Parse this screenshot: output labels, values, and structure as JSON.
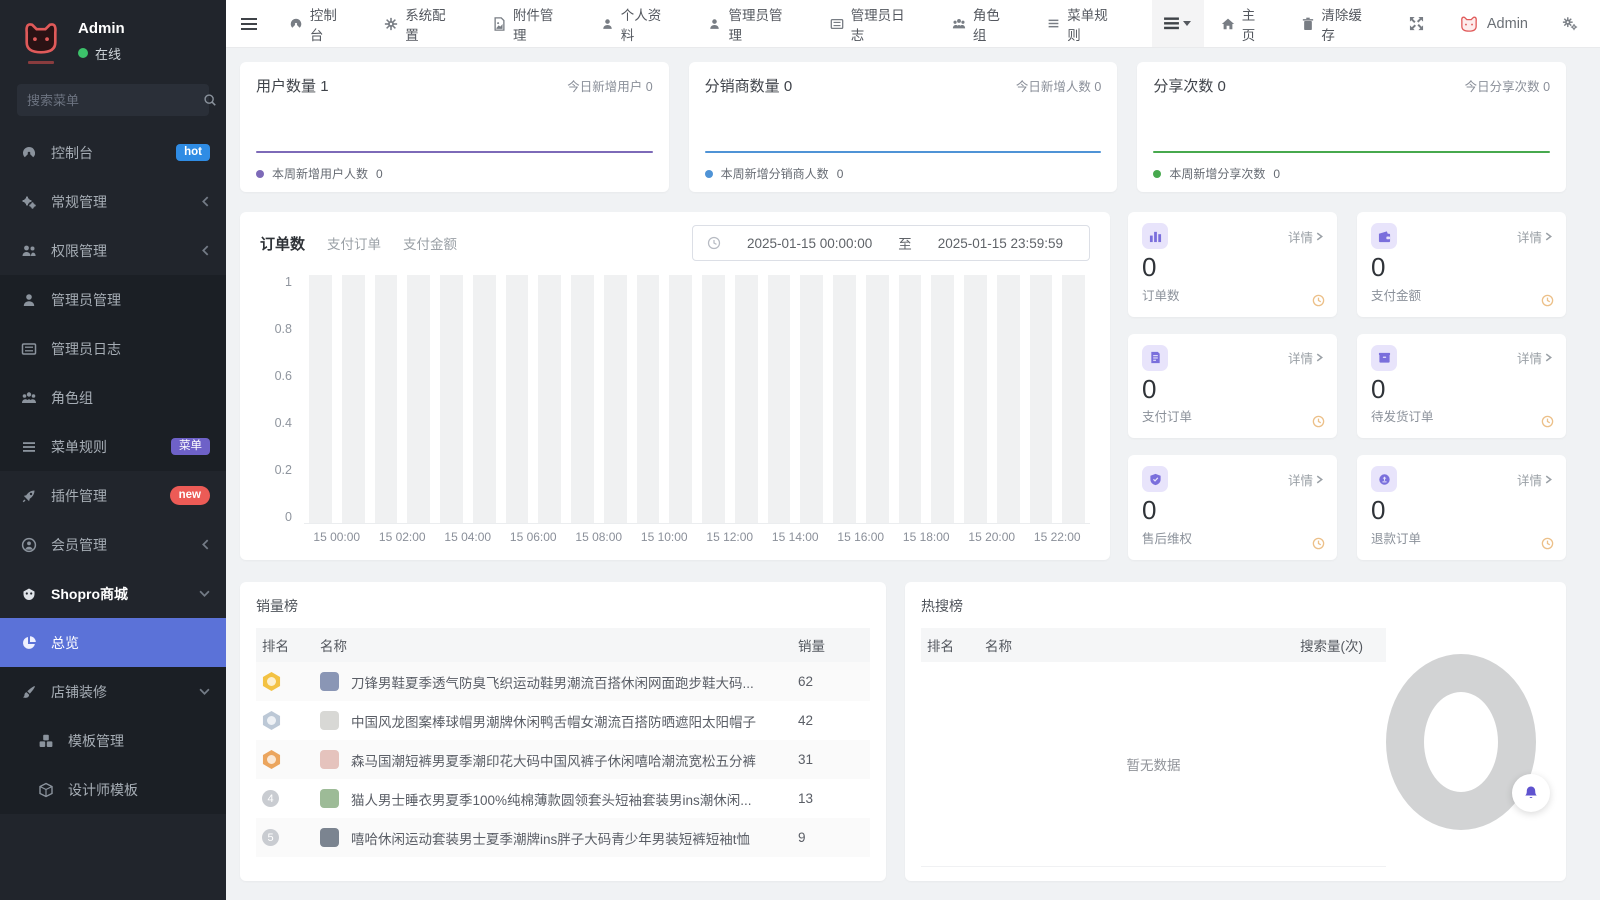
{
  "topbar": {
    "menu": [
      {
        "icon": "dashboard-icon",
        "label": "控制台"
      },
      {
        "icon": "gear-icon",
        "label": "系统配置"
      },
      {
        "icon": "attachment-icon",
        "label": "附件管理"
      },
      {
        "icon": "user-icon",
        "label": "个人资料"
      },
      {
        "icon": "admin-icon",
        "label": "管理员管理"
      },
      {
        "icon": "log-icon",
        "label": "管理员日志"
      },
      {
        "icon": "roles-icon",
        "label": "角色组"
      },
      {
        "icon": "menu-rules-icon",
        "label": "菜单规则"
      }
    ],
    "home_label": "主页",
    "clear_cache_label": "清除缓存",
    "username": "Admin"
  },
  "sidebar": {
    "user": {
      "name": "Admin",
      "status": "在线"
    },
    "search_placeholder": "搜索菜单",
    "items": [
      {
        "label": "控制台",
        "badge": "hot",
        "badge_color": "#2f8ce4"
      },
      {
        "label": "常规管理"
      },
      {
        "label": "权限管理"
      },
      {
        "label": "管理员管理"
      },
      {
        "label": "管理员日志"
      },
      {
        "label": "角色组"
      },
      {
        "label": "菜单规则",
        "badge": "菜单",
        "badge_color": "#6e61c8"
      },
      {
        "label": "插件管理",
        "badge": "new",
        "badge_color": "#ec5b56"
      },
      {
        "label": "会员管理"
      },
      {
        "label": "Shopro商城"
      },
      {
        "label": "总览",
        "active": true,
        "active_color": "#5b72d8"
      },
      {
        "label": "店铺装修"
      },
      {
        "label": "模板管理"
      },
      {
        "label": "设计师模板"
      }
    ]
  },
  "stat_cards": [
    {
      "title": "用户数量",
      "value": "1",
      "right_label": "今日新增用户",
      "right_value": "0",
      "legend": "本周新增用户人数",
      "legend_value": "0",
      "color": "#7d6ab8"
    },
    {
      "title": "分销商数量",
      "value": "0",
      "right_label": "今日新增人数",
      "right_value": "0",
      "legend": "本周新增分销商人数",
      "legend_value": "0",
      "color": "#4f93d6"
    },
    {
      "title": "分享次数",
      "value": "0",
      "right_label": "今日分享次数",
      "right_value": "0",
      "legend": "本周新增分享次数",
      "legend_value": "0",
      "color": "#47a94e"
    }
  ],
  "order_panel": {
    "tabs": [
      "订单数",
      "支付订单",
      "支付金额"
    ],
    "date_start": "2025-01-15 00:00:00",
    "date_separator": "至",
    "date_end": "2025-01-15 23:59:59"
  },
  "chart_data": [
    {
      "name": "orders-by-hour",
      "type": "bar",
      "title": "订单数 2025-01-15",
      "hours": 24,
      "x_tick_labels": [
        "15 00:00",
        "15 02:00",
        "15 04:00",
        "15 06:00",
        "15 08:00",
        "15 10:00",
        "15 12:00",
        "15 14:00",
        "15 16:00",
        "15 18:00",
        "15 20:00",
        "15 22:00"
      ],
      "y_tick_labels": [
        "1",
        "0.8",
        "0.6",
        "0.4",
        "0.2",
        "0"
      ],
      "ylim": [
        0,
        1
      ],
      "values": [
        0,
        0,
        0,
        0,
        0,
        0,
        0,
        0,
        0,
        0,
        0,
        0,
        0,
        0,
        0,
        0,
        0,
        0,
        0,
        0,
        0,
        0,
        0,
        0
      ],
      "background_bars_full_height": true,
      "bar_color": "#f0f1f2",
      "grid": false
    },
    {
      "name": "weekly-new-users",
      "type": "line",
      "series": [
        {
          "name": "本周新增用户人数",
          "values": [
            0,
            0,
            0,
            0,
            0,
            0,
            0
          ]
        }
      ],
      "line_color": "#7d6ab8",
      "flat_zero_line": true
    },
    {
      "name": "weekly-new-distributors",
      "type": "line",
      "series": [
        {
          "name": "本周新增分销商人数",
          "values": [
            0,
            0,
            0,
            0,
            0,
            0,
            0
          ]
        }
      ],
      "line_color": "#4f93d6",
      "flat_zero_line": true
    },
    {
      "name": "weekly-new-shares",
      "type": "line",
      "series": [
        {
          "name": "本周新增分享次数",
          "values": [
            0,
            0,
            0,
            0,
            0,
            0,
            0
          ]
        }
      ],
      "line_color": "#47a94e",
      "flat_zero_line": true
    },
    {
      "name": "hot-search-donut",
      "type": "pie",
      "values": [],
      "empty": true,
      "ring_color": "#d2d3d4"
    }
  ],
  "tiles": [
    {
      "label": "订单数",
      "value": "0",
      "detail": "详情",
      "icon": "bar-chart-icon"
    },
    {
      "label": "支付金额",
      "value": "0",
      "detail": "详情",
      "icon": "wallet-icon"
    },
    {
      "label": "支付订单",
      "value": "0",
      "detail": "详情",
      "icon": "invoice-icon"
    },
    {
      "label": "待发货订单",
      "value": "0",
      "detail": "详情",
      "icon": "package-icon"
    },
    {
      "label": "售后维权",
      "value": "0",
      "detail": "详情",
      "icon": "shield-icon"
    },
    {
      "label": "退款订单",
      "value": "0",
      "detail": "详情",
      "icon": "refund-icon"
    }
  ],
  "sales_panel": {
    "title": "销量榜",
    "columns": {
      "rank": "排名",
      "name": "名称",
      "sales": "销量"
    },
    "rows": [
      {
        "rank": 1,
        "name": "刀锋男鞋夏季透气防臭飞织运动鞋男潮流百搭休闲网面跑步鞋大码...",
        "sales": "62",
        "thumb_color": "#8a96b5",
        "medal_color": "#f3c243"
      },
      {
        "rank": 2,
        "name": "中国风龙图案棒球帽男潮牌休闲鸭舌帽女潮流百搭防晒遮阳太阳帽子",
        "sales": "42",
        "thumb_color": "#d8d8d5",
        "medal_color": "#bcc8d6"
      },
      {
        "rank": 3,
        "name": "森马国潮短裤男夏季潮印花大码中国风裤子休闲嘻哈潮流宽松五分裤",
        "sales": "31",
        "thumb_color": "#e5c3bd",
        "medal_color": "#eba55e"
      },
      {
        "rank": 4,
        "name": "猫人男士睡衣男夏季100%纯棉薄款圆领套头短袖套装男ins潮休闲...",
        "sales": "13",
        "thumb_color": "#9dbb97"
      },
      {
        "rank": 5,
        "name": "嘻哈休闲运动套装男士夏季潮牌ins胖子大码青少年男装短裤短袖t恤",
        "sales": "9",
        "thumb_color": "#7b8490"
      }
    ]
  },
  "hot_search_panel": {
    "title": "热搜榜",
    "columns": {
      "rank": "排名",
      "name": "名称",
      "count": "搜索量(次)"
    },
    "empty_text": "暂无数据"
  }
}
